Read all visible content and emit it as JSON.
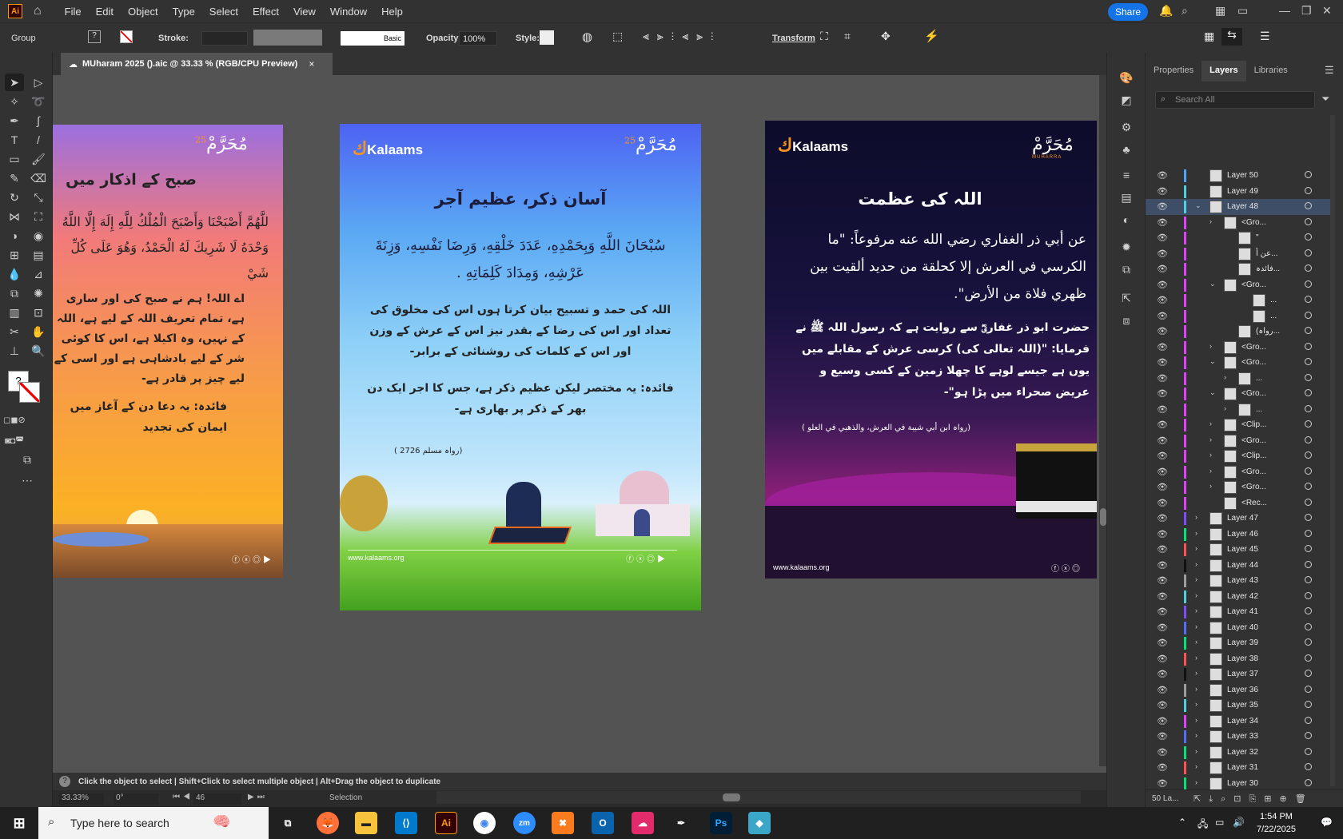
{
  "app": {
    "logo": "Ai",
    "share_label": "Share"
  },
  "menu": [
    "File",
    "Edit",
    "Object",
    "Type",
    "Select",
    "Effect",
    "View",
    "Window",
    "Help"
  ],
  "control": {
    "selection": "Group",
    "stroke_label": "Stroke:",
    "brush": "Basic",
    "opacity_label": "Opacity:",
    "opacity_value": "100%",
    "style_label": "Style:",
    "transform_label": "Transform"
  },
  "document": {
    "tab_title": "MUharam 2025 ().aic @ 33.33 % (RGB/CPU Preview)",
    "close": "×"
  },
  "artboards": [
    {
      "brand_mark": "مُحَرَّمْ",
      "brand_num": "25",
      "title": "صبح کے اذکار میں",
      "arabic": "للَّهُمَّ أَصْبَحْنَا وَأَصْبَحَ الْمُلْكُ لِلَّهِ إِلَهَ إِلَّا اللَّهُ وَحْدَهُ لَا شَرِيكَ لَهُ الْحَمْدُ، وَهُوَ عَلَى كُلِّ شَيْ",
      "urdu": "اے اللہ! ہم نے صبح کی اور ساری ہے، تمام تعریف اللہ کے لیے ہے، اللہ کے نہیں، وہ اکیلا ہے، اس کا کوئی شر کے لیے بادشاہی ہے اور اسی کے لیے چیز پر قادر ہے-",
      "benefit": "فائدہ: یہ دعا دن کے آغاز میں ایمان کی تجدید"
    },
    {
      "logo": "Kalaams",
      "brand_mark": "مُحَرَّمْ",
      "brand_num": "25",
      "title": "آسان ذکر، عظیم آجر",
      "arabic": "سُبْحَانَ اللَّهِ وَبِحَمْدِهِ، عَدَدَ خَلْقِهِ، وَرِضَا نَفْسِهِ، وَزِنَةَ عَرْشِهِ، وَمِدَادَ كَلِمَاتِهِ .",
      "urdu": "اللہ کی حمد و تسبیح بیان کرتا ہوں اس کی مخلوق کی تعداد اور اس کی رضا کے بقدر نیز اس کے عرش کے وزن اور اس کے کلمات کی روشنائی کے برابر-",
      "benefit": "فائدہ: یہ مختصر لیکن عظیم ذکر ہے، جس کا اجر ایک دن بھر کے ذکر پر بھاری ہے-",
      "reference": "(رواہ مسلم 2726 )",
      "url": "www.kalaams.org",
      "social": "f x ◎ ▶"
    },
    {
      "logo": "Kalaams",
      "brand_mark": "مُحَرَّمْ",
      "brand_sub": "MUHARRA",
      "title": "اللہ کی عظمت",
      "arabic": "عن أبي ذر الغفاري رضي الله عنه مرفوعاً: \"ما الكرسي في العرش إلا كحلقة من حديد ألقيت بين ظهري فلاة من الأرض\".",
      "urdu": "حضرت ابو ذر غفاریؓ سے روایت ہے کہ رسول اللہ ﷺ نے فرمایا: \"(اللہ تعالی کی) کرسی عرش کے مقابلے میں یوں ہے جیسے لوہے کا چھلا زمین کے کسی وسیع و عریض صحراء میں پڑا ہو\"-",
      "reference": "(رواہ ابن أبي شيبة في العرش، والذهبي في العلو )",
      "url": "www.kalaams.org",
      "social": "f x ◎"
    }
  ],
  "panel": {
    "tabs": [
      "Properties",
      "Layers",
      "Libraries"
    ],
    "search_placeholder": "Search All",
    "footer": "50 La..."
  },
  "layers": [
    {
      "name": "Layer 50",
      "indent": 0,
      "twirl": "",
      "color": "#4da3ff"
    },
    {
      "name": "Layer 49",
      "indent": 0,
      "twirl": "",
      "color": "#4dd0e1"
    },
    {
      "name": "Layer 48",
      "indent": 0,
      "twirl": "v",
      "color": "#4dd0e1",
      "selected": true
    },
    {
      "name": "<Gro...",
      "indent": 1,
      "twirl": ">",
      "color": "#e040fb"
    },
    {
      "name": "\"",
      "indent": 2,
      "twirl": "",
      "color": "#e040fb"
    },
    {
      "name": "عن أ...",
      "indent": 2,
      "twirl": "",
      "color": "#e040fb"
    },
    {
      "name": "فائدہ...",
      "indent": 2,
      "twirl": "",
      "color": "#e040fb"
    },
    {
      "name": "<Gro...",
      "indent": 1,
      "twirl": "v",
      "color": "#e040fb"
    },
    {
      "name": "...",
      "indent": 3,
      "twirl": "",
      "color": "#e040fb"
    },
    {
      "name": "...",
      "indent": 3,
      "twirl": "",
      "color": "#e040fb"
    },
    {
      "name": "(رواہ...",
      "indent": 2,
      "twirl": "",
      "color": "#e040fb"
    },
    {
      "name": "<Gro...",
      "indent": 1,
      "twirl": ">",
      "color": "#e040fb"
    },
    {
      "name": "<Gro...",
      "indent": 1,
      "twirl": "v",
      "color": "#e040fb"
    },
    {
      "name": "...",
      "indent": 2,
      "twirl": ">",
      "color": "#e040fb"
    },
    {
      "name": "<Gro...",
      "indent": 1,
      "twirl": "v",
      "color": "#e040fb"
    },
    {
      "name": "...",
      "indent": 2,
      "twirl": ">",
      "color": "#e040fb"
    },
    {
      "name": "<Clip...",
      "indent": 1,
      "twirl": ">",
      "color": "#e040fb"
    },
    {
      "name": "<Gro...",
      "indent": 1,
      "twirl": ">",
      "color": "#e040fb"
    },
    {
      "name": "<Clip...",
      "indent": 1,
      "twirl": ">",
      "color": "#e040fb"
    },
    {
      "name": "<Gro...",
      "indent": 1,
      "twirl": ">",
      "color": "#e040fb"
    },
    {
      "name": "<Gro...",
      "indent": 1,
      "twirl": ">",
      "color": "#e040fb"
    },
    {
      "name": "<Rec...",
      "indent": 1,
      "twirl": "",
      "color": "#e040fb"
    },
    {
      "name": "Layer 47",
      "indent": 0,
      "twirl": ">",
      "color": "#7c4dff"
    },
    {
      "name": "Layer 46",
      "indent": 0,
      "twirl": ">",
      "color": "#00e676"
    },
    {
      "name": "Layer 45",
      "indent": 0,
      "twirl": ">",
      "color": "#ff5252"
    },
    {
      "name": "Layer 44",
      "indent": 0,
      "twirl": ">",
      "color": "#111111"
    },
    {
      "name": "Layer 43",
      "indent": 0,
      "twirl": ">",
      "color": "#9e9e9e"
    },
    {
      "name": "Layer 42",
      "indent": 0,
      "twirl": ">",
      "color": "#4dd0e1"
    },
    {
      "name": "Layer 41",
      "indent": 0,
      "twirl": ">",
      "color": "#7c4dff"
    },
    {
      "name": "Layer 40",
      "indent": 0,
      "twirl": ">",
      "color": "#536dfe"
    },
    {
      "name": "Layer 39",
      "indent": 0,
      "twirl": ">",
      "color": "#00e676"
    },
    {
      "name": "Layer 38",
      "indent": 0,
      "twirl": ">",
      "color": "#ff5252"
    },
    {
      "name": "Layer 37",
      "indent": 0,
      "twirl": ">",
      "color": "#111111"
    },
    {
      "name": "Layer 36",
      "indent": 0,
      "twirl": ">",
      "color": "#9e9e9e"
    },
    {
      "name": "Layer 35",
      "indent": 0,
      "twirl": ">",
      "color": "#4dd0e1"
    },
    {
      "name": "Layer 34",
      "indent": 0,
      "twirl": ">",
      "color": "#e040fb"
    },
    {
      "name": "Layer 33",
      "indent": 0,
      "twirl": ">",
      "color": "#536dfe"
    },
    {
      "name": "Layer 32",
      "indent": 0,
      "twirl": ">",
      "color": "#00e676"
    },
    {
      "name": "Layer 31",
      "indent": 0,
      "twirl": ">",
      "color": "#ff5252"
    },
    {
      "name": "Layer 30",
      "indent": 0,
      "twirl": ">",
      "color": "#00e676"
    }
  ],
  "status": {
    "hint": "Click the object to select  |  Shift+Click to select multiple object  |  Alt+Drag the object to duplicate",
    "zoom": "33.33%",
    "rotate": "0°",
    "artboard": "46",
    "tool": "Selection"
  },
  "taskbar": {
    "search_placeholder": "Type here to search",
    "time": "1:54 PM",
    "date": "7/22/2025"
  },
  "colors": {
    "accent": "#1473e6",
    "kalaams_orange": "#f7931e",
    "ui_bg": "#323232",
    "canvas_bg": "#535353"
  }
}
